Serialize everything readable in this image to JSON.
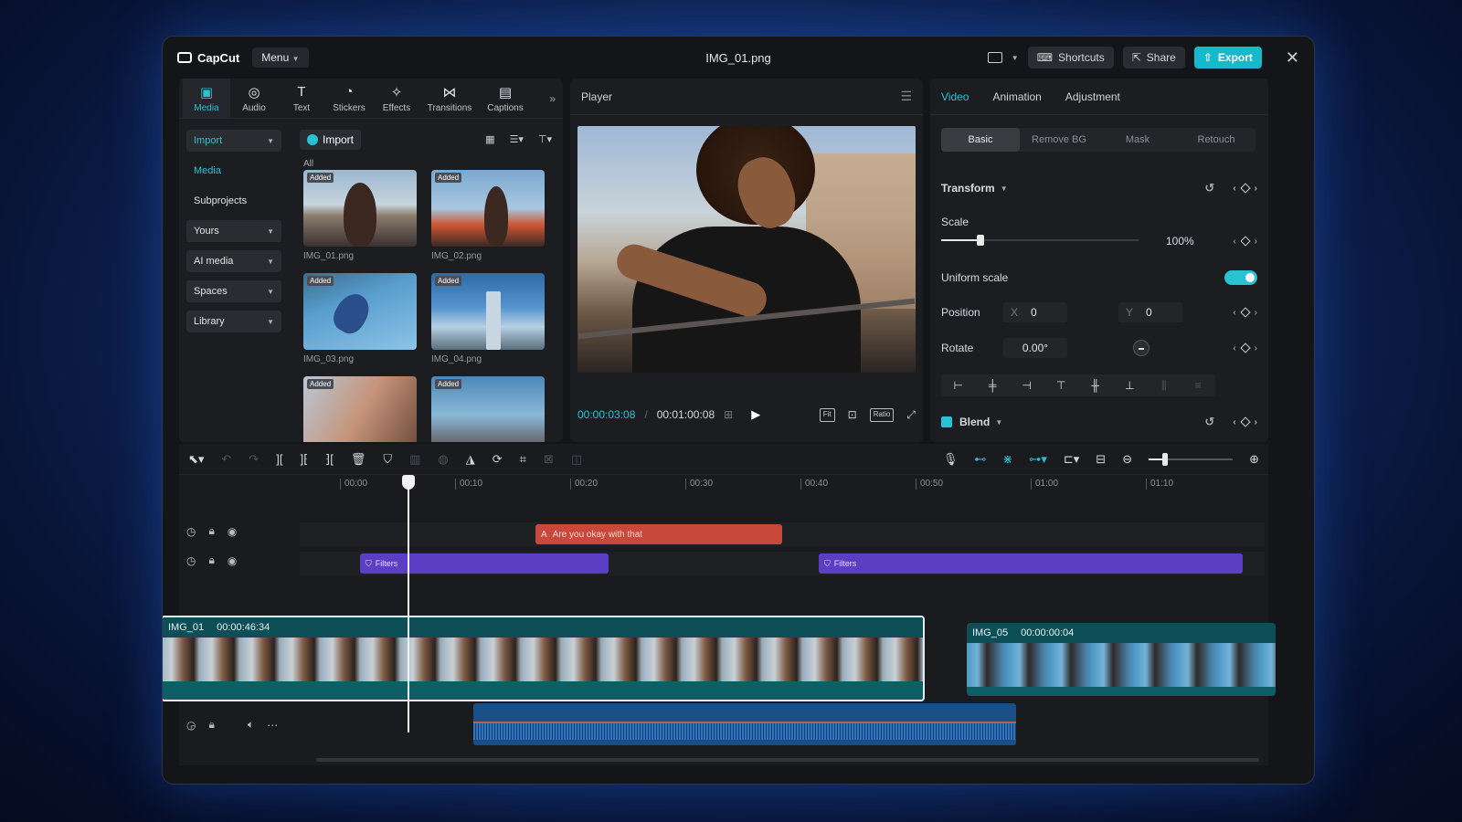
{
  "app": {
    "logo": "CapCut",
    "menu": "Menu",
    "file_title": "IMG_01.png",
    "shortcuts": "Shortcuts",
    "share": "Share",
    "export": "Export",
    "accent": "#27c3d5"
  },
  "media_panel": {
    "tabs": [
      {
        "label": "Media",
        "icon": "media-icon"
      },
      {
        "label": "Audio",
        "icon": "audio-icon"
      },
      {
        "label": "Text",
        "icon": "text-icon"
      },
      {
        "label": "Stickers",
        "icon": "stickers-icon"
      },
      {
        "label": "Effects",
        "icon": "effects-icon"
      },
      {
        "label": "Transitions",
        "icon": "transitions-icon"
      },
      {
        "label": "Captions",
        "icon": "captions-icon"
      }
    ],
    "side_nav": {
      "import": "Import",
      "media": "Media",
      "subprojects": "Subprojects",
      "yours": "Yours",
      "ai_media": "AI media",
      "spaces": "Spaces",
      "library": "Library"
    },
    "import_button": "Import",
    "all_label": "All",
    "items": [
      {
        "name": "IMG_01.png",
        "badge": "Added"
      },
      {
        "name": "IMG_02.png",
        "badge": "Added"
      },
      {
        "name": "IMG_03.png",
        "badge": "Added"
      },
      {
        "name": "IMG_04.png",
        "badge": "Added"
      },
      {
        "name": "",
        "badge": "Added"
      },
      {
        "name": "",
        "badge": "Added"
      }
    ]
  },
  "player": {
    "title": "Player",
    "current_time": "00:00:03:08",
    "total_time": "00:01:00:08",
    "ratio_label": "Ratio"
  },
  "properties": {
    "tabs": [
      "Video",
      "Animation",
      "Adjustment"
    ],
    "sub_tabs": [
      "Basic",
      "Remove BG",
      "Mask",
      "Retouch"
    ],
    "transform_label": "Transform",
    "scale_label": "Scale",
    "scale_value": "100%",
    "scale_fraction": 0.2,
    "uniform_scale_label": "Uniform scale",
    "position_label": "Position",
    "pos_x_label": "X",
    "pos_x": "0",
    "pos_y_label": "Y",
    "pos_y": "0",
    "rotate_label": "Rotate",
    "rotate_value": "0.00°",
    "blend_label": "Blend"
  },
  "timeline": {
    "ruler": [
      "00:00",
      "00:10",
      "00:20",
      "00:30",
      "00:40",
      "00:50",
      "01:00",
      "01:10"
    ],
    "text_clip": "Are you okay with that",
    "fx_clip_1": "Filters",
    "fx_clip_2": "Filters",
    "main_clip_name": "IMG_01",
    "main_clip_duration": "00:00:46:34",
    "clip2_name": "IMG_05",
    "clip2_duration": "00:00:00:04",
    "zoom_fraction": 0.2
  }
}
